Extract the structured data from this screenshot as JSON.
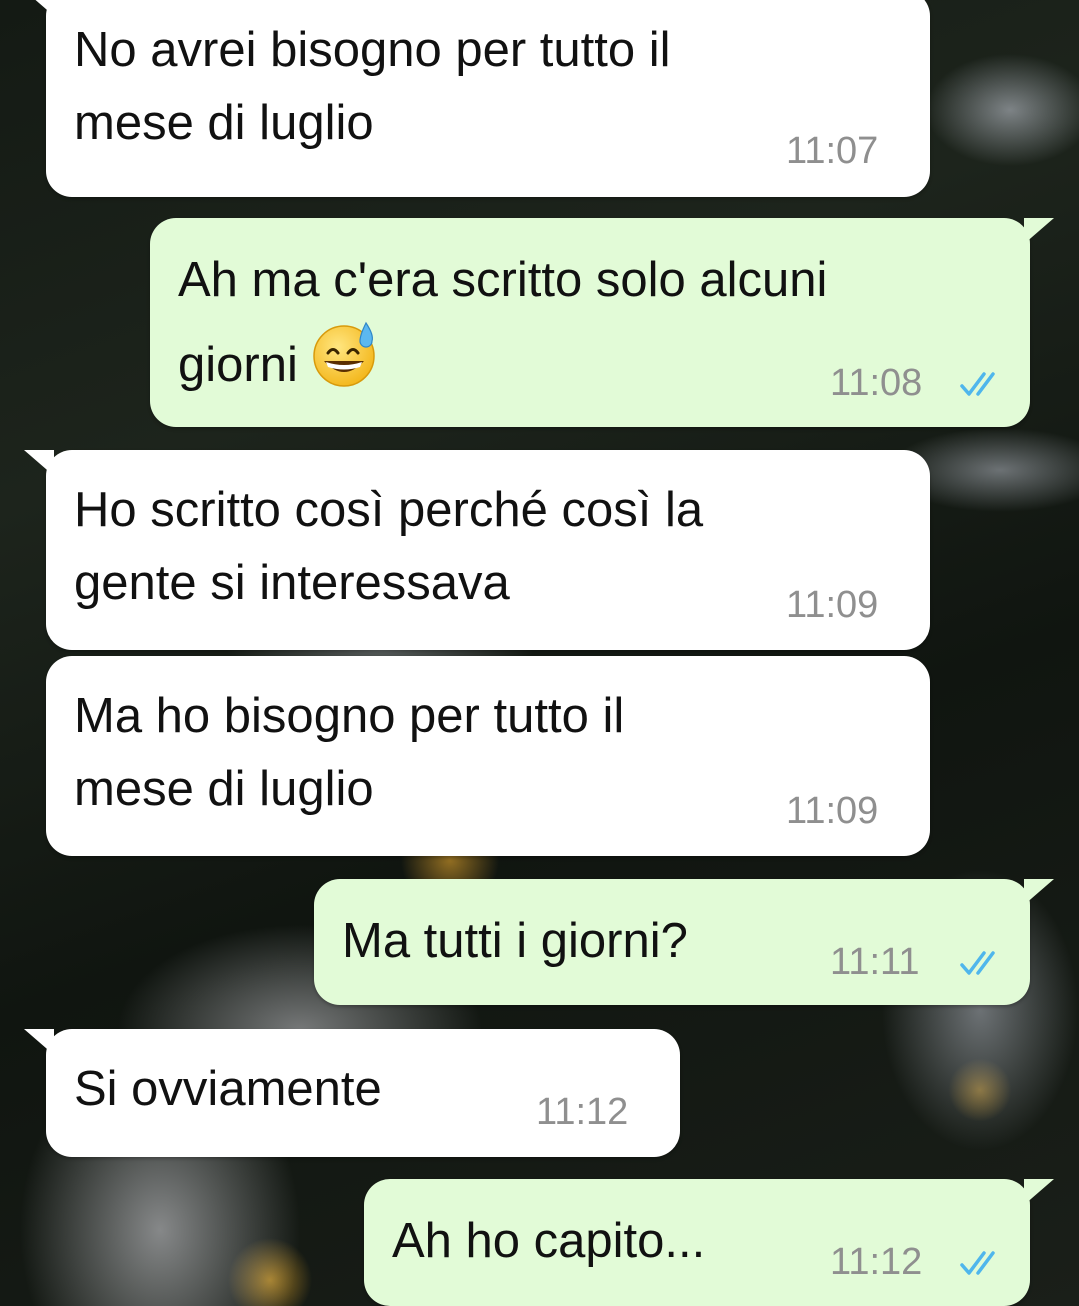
{
  "messages": [
    {
      "direction": "incoming",
      "lines": [
        "No avrei bisogno per tutto il",
        "mese di luglio"
      ],
      "time": "11:07"
    },
    {
      "direction": "outgoing",
      "lines": [
        "Ah ma c'era scritto solo alcuni",
        "giorni"
      ],
      "emoji": "grinning-sweat-emoji",
      "time": "11:08",
      "status": "read"
    },
    {
      "direction": "incoming",
      "lines": [
        "Ho scritto così perché così la",
        "gente si interessava"
      ],
      "time": "11:09"
    },
    {
      "direction": "incoming",
      "lines": [
        "Ma ho bisogno per tutto il",
        "mese di luglio"
      ],
      "time": "11:09"
    },
    {
      "direction": "outgoing",
      "lines": [
        "Ma tutti i giorni?"
      ],
      "time": "11:11",
      "status": "read"
    },
    {
      "direction": "incoming",
      "lines": [
        "Si ovviamente"
      ],
      "time": "11:12"
    },
    {
      "direction": "outgoing",
      "lines": [
        "Ah ho capito..."
      ],
      "time": "11:12",
      "status": "read"
    }
  ],
  "colors": {
    "incoming_bubble": "#ffffff",
    "outgoing_bubble": "#e2fbd7",
    "read_ticks": "#4fb6ec",
    "timestamp": "#8f8f8f"
  }
}
